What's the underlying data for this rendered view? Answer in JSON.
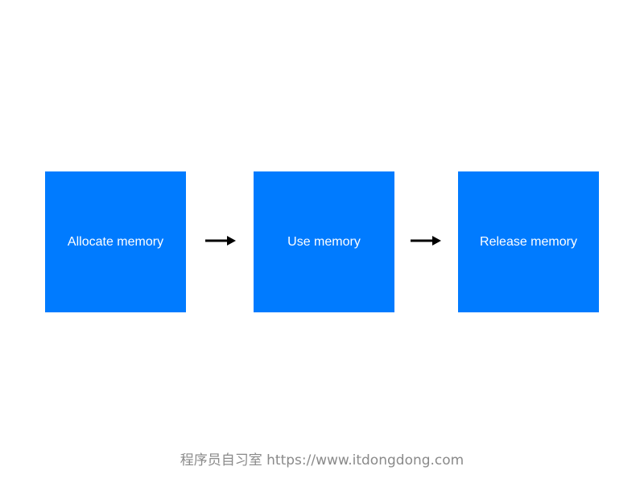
{
  "diagram": {
    "steps": [
      {
        "label": "Allocate memory",
        "color": "#007bff"
      },
      {
        "label": "Use memory",
        "color": "#007bff"
      },
      {
        "label": "Release memory",
        "color": "#007bff"
      }
    ],
    "connectors": [
      {
        "icon": "right-arrow-icon"
      },
      {
        "icon": "right-arrow-icon"
      }
    ]
  },
  "watermark": {
    "text": "程序员自习室 https://www.itdongdong.com"
  },
  "colors": {
    "background": "#ffffff",
    "box": "#007bff",
    "box_text": "#ffffff",
    "arrow": "#000000",
    "watermark": "#8a8a8a"
  }
}
